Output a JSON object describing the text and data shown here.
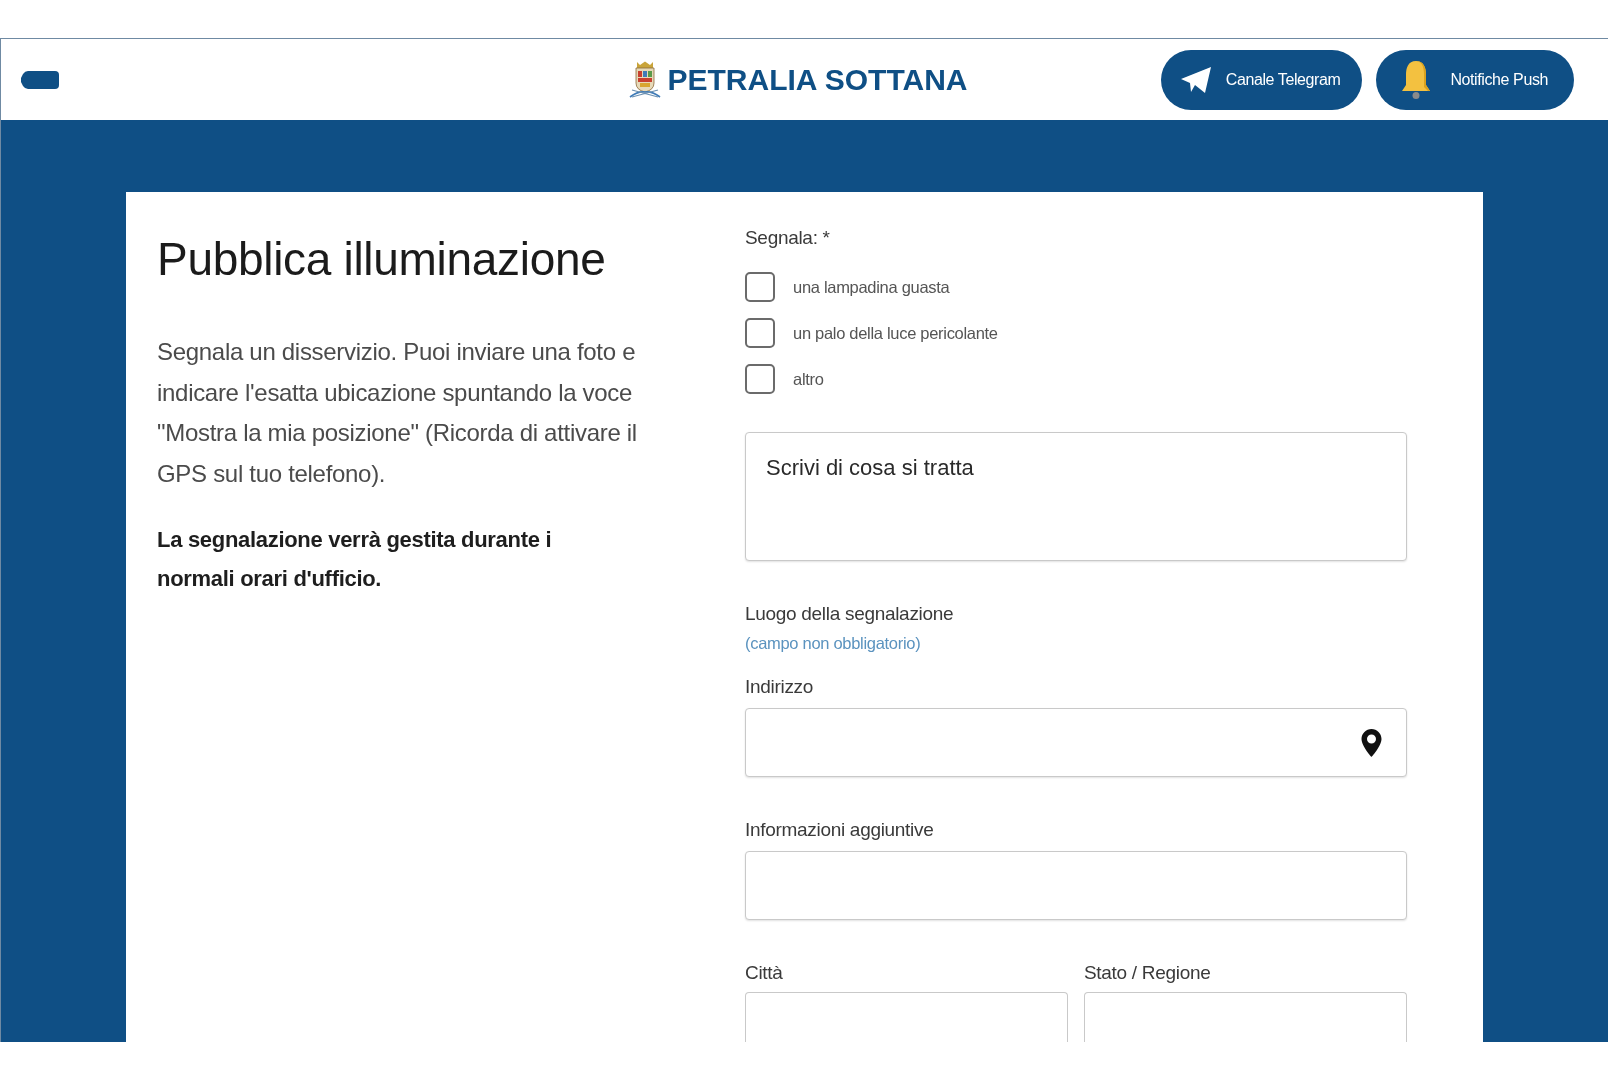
{
  "header": {
    "title": "PETRALIA SOTTANA",
    "buttons": [
      {
        "label": "Canale Telegram",
        "kind": "telegram"
      },
      {
        "label": "Notifiche Push",
        "kind": "bell"
      }
    ]
  },
  "intro": {
    "title": "Pubblica illuminazione",
    "description": "Segnala un disservizio. Puoi inviare una foto e indicare l'esatta ubicazione spuntando la voce \"Mostra la mia posizione\" (Ricorda di attivare il GPS sul tuo telefono).",
    "note": "La segnalazione verrà gestita durante i normali orari d'ufficio."
  },
  "form": {
    "report_label": "Segnala: *",
    "options": [
      {
        "label": "una lampadina guasta",
        "checked": false
      },
      {
        "label": "un palo della luce pericolante",
        "checked": false
      },
      {
        "label": "altro",
        "checked": false
      }
    ],
    "description_field": {
      "placeholder": "Scrivi di cosa si tratta"
    },
    "location": {
      "title": "Luogo della segnalazione",
      "hint": "(campo non obbligatorio)"
    },
    "fields": [
      {
        "label": "Indirizzo",
        "kind": "address"
      },
      {
        "label": "Informazioni aggiuntive",
        "kind": "text"
      }
    ],
    "row_fields": [
      {
        "label": "Città"
      },
      {
        "label": "Stato / Regione"
      }
    ]
  }
}
